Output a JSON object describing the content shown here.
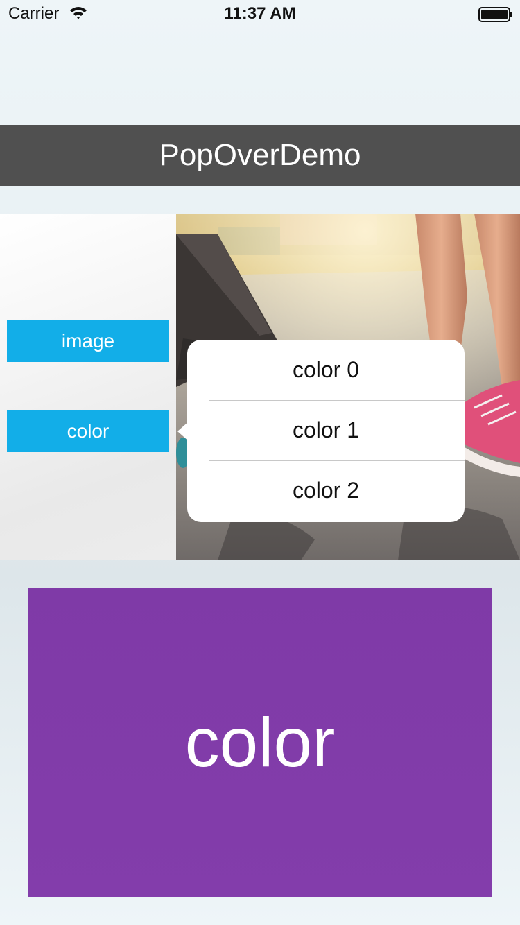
{
  "status_bar": {
    "carrier": "Carrier",
    "time": "11:37 AM",
    "wifi_icon": "wifi-icon",
    "battery_icon": "battery-icon"
  },
  "nav": {
    "title": "PopOverDemo"
  },
  "buttons": {
    "image_label": "image",
    "color_label": "color",
    "color": "#12aee8"
  },
  "popover": {
    "items": [
      {
        "label": "color 0"
      },
      {
        "label": "color 1"
      },
      {
        "label": "color 2"
      }
    ]
  },
  "display": {
    "label": "color",
    "color": "#7f3aa7"
  },
  "colors": {
    "title_bar": "#505050",
    "background": "#eef5f8"
  }
}
